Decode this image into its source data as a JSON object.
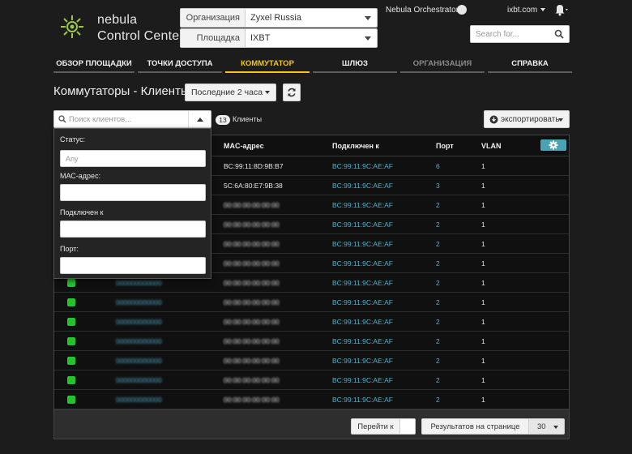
{
  "brand": {
    "line1": "nebula",
    "line2": "Control Center",
    "accent": "#f5c518",
    "logo_color": "#9bc84a"
  },
  "header": {
    "org_label": "Организация",
    "org_value": "Zyxel Russia",
    "site_label": "Площадка",
    "site_value": "IXBT",
    "orchestrator": "Nebula Orchestrator",
    "user": "ixbt.com",
    "search_placeholder": "Search for..."
  },
  "nav": [
    {
      "label": "ОБЗОР ПЛОЩАДКИ",
      "state": "normal"
    },
    {
      "label": "ТОЧКИ ДОСТУПА",
      "state": "normal"
    },
    {
      "label": "КОММУТАТОР",
      "state": "active"
    },
    {
      "label": "ШЛЮЗ",
      "state": "normal"
    },
    {
      "label": "ОРГАНИЗАЦИЯ",
      "state": "dim"
    },
    {
      "label": "СПРАВКА",
      "state": "normal"
    }
  ],
  "page": {
    "title": "Коммутаторы - Клиенты",
    "period": "Последние 2 часа",
    "filter_placeholder": "Поиск клиентов...",
    "count": "13",
    "count_label": "Клиенты",
    "export_label": "экспортировать"
  },
  "filter_panel": {
    "status_label": "Статус:",
    "status_placeholder": "Any",
    "mac_label": "МАС-адрес:",
    "connected_label": "Подключен к",
    "port_label": "Порт:"
  },
  "table": {
    "headers": {
      "mac": "MAC-адрес",
      "connected": "Подключен к",
      "port": "Порт",
      "vlan": "VLAN"
    },
    "rows": [
      {
        "name": "",
        "mac": "BC:99:11:8D:9B:B7",
        "connected": "BC:99:11:9C:AE:AF",
        "port": "6",
        "vlan": "1",
        "mac_blur": false,
        "port_link": true
      },
      {
        "name": "",
        "mac": "5C:6A:80:E7:9B:38",
        "connected": "BC:99:11:9C:AE:AF",
        "port": "3",
        "vlan": "1",
        "mac_blur": false,
        "port_link": true
      },
      {
        "name": "",
        "mac": "00:00:00:00:00:00",
        "connected": "BC:99:11:9C:AE:AF",
        "port": "2",
        "vlan": "1",
        "mac_blur": true,
        "port_link": true
      },
      {
        "name": "",
        "mac": "00:00:00:00:00:00",
        "connected": "BC:99:11:9C:AE:AF",
        "port": "2",
        "vlan": "1",
        "mac_blur": true,
        "port_link": true
      },
      {
        "name": "",
        "mac": "00:00:00:00:00:00",
        "connected": "BC:99:11:9C:AE:AF",
        "port": "2",
        "vlan": "1",
        "mac_blur": true,
        "port_link": true
      },
      {
        "name": "",
        "mac": "00:00:00:00:00:00",
        "connected": "BC:99:11:9C:AE:AF",
        "port": "2",
        "vlan": "1",
        "mac_blur": true,
        "port_link": true
      },
      {
        "name": "000000000000",
        "mac": "00:00:00:00:00:00",
        "connected": "BC:99:11:9C:AE:AF",
        "port": "2",
        "vlan": "1",
        "mac_blur": true,
        "port_link": true
      },
      {
        "name": "000000000000",
        "mac": "00:00:00:00:00:00",
        "connected": "BC:99:11:9C:AE:AF",
        "port": "2",
        "vlan": "1",
        "mac_blur": true,
        "port_link": true
      },
      {
        "name": "000000000000",
        "mac": "00:00:00:00:00:00",
        "connected": "BC:99:11:9C:AE:AF",
        "port": "2",
        "vlan": "1",
        "mac_blur": true,
        "port_link": true
      },
      {
        "name": "000000000000",
        "mac": "00:00:00:00:00:00",
        "connected": "BC:99:11:9C:AE:AF",
        "port": "2",
        "vlan": "1",
        "mac_blur": true,
        "port_link": true
      },
      {
        "name": "000000000000",
        "mac": "00:00:00:00:00:00",
        "connected": "BC:99:11:9C:AE:AF",
        "port": "2",
        "vlan": "1",
        "mac_blur": true,
        "port_link": true
      },
      {
        "name": "000000000000",
        "mac": "00:00:00:00:00:00",
        "connected": "BC:99:11:9C:AE:AF",
        "port": "2",
        "vlan": "1",
        "mac_blur": true,
        "port_link": true
      },
      {
        "name": "000000000000",
        "mac": "00:00:00:00:00:00",
        "connected": "BC:99:11:9C:AE:AF",
        "port": "2",
        "vlan": "1",
        "mac_blur": true,
        "port_link": true
      }
    ]
  },
  "pagination": {
    "goto_label": "Перейти к",
    "rpp_label": "Результатов на странице",
    "rpp_value": "30"
  }
}
